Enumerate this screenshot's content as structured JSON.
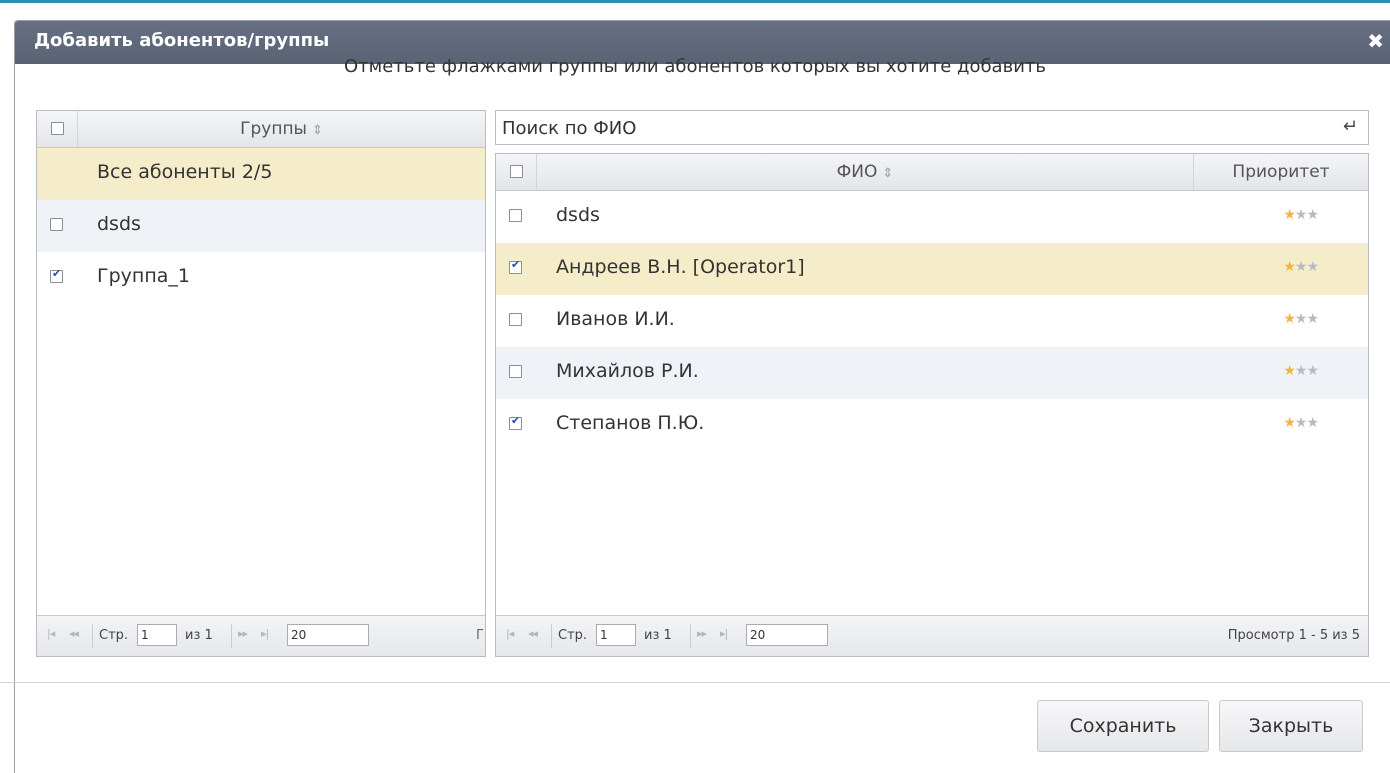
{
  "dialog": {
    "title": "Добавить абонентов/группы",
    "instruction": "Отметьте флажками группы или абонентов которых вы хотите добавить"
  },
  "groups": {
    "header": "Группы",
    "rows": [
      {
        "label": "Все абоненты 2/5",
        "checkbox": false,
        "checked": false,
        "highlight": true
      },
      {
        "label": "dsds",
        "checkbox": true,
        "checked": false,
        "alt": true
      },
      {
        "label": "Группа_1",
        "checkbox": true,
        "checked": true
      }
    ],
    "pager": {
      "page_label": "Стр.",
      "page": "1",
      "of_label": "из 1",
      "page_size": "20",
      "trailing": "Г"
    }
  },
  "search": {
    "placeholder": "Поиск по ФИО"
  },
  "subscribers": {
    "headers": {
      "fio": "ФИО",
      "priority": "Приоритет"
    },
    "rows": [
      {
        "name": "dsds",
        "checked": false,
        "priority": 1
      },
      {
        "name": "Андреев В.Н. [Operator1]",
        "checked": true,
        "priority": 1,
        "highlight": true
      },
      {
        "name": "Иванов И.И.",
        "checked": false,
        "priority": 1
      },
      {
        "name": "Михайлов Р.И.",
        "checked": false,
        "priority": 1,
        "alt": true
      },
      {
        "name": "Степанов П.Ю.",
        "checked": true,
        "priority": 1
      }
    ],
    "priority_max": 3,
    "pager": {
      "page_label": "Стр.",
      "page": "1",
      "of_label": "из 1",
      "page_size": "20",
      "view_info": "Просмотр 1 - 5 из 5"
    }
  },
  "buttons": {
    "save": "Сохранить",
    "close": "Закрыть"
  },
  "colors": {
    "titlebar": "#5e6778",
    "highlight": "#f5ecc9",
    "alt_row": "#eff3f8",
    "star_on": "#f2b63c",
    "star_off": "#b7bbc1"
  }
}
